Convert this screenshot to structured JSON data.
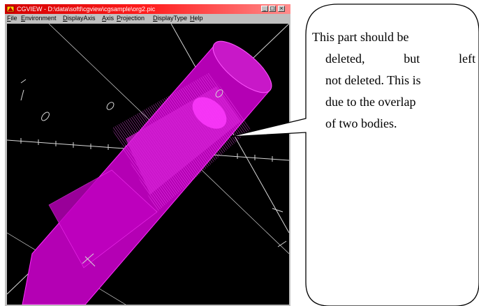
{
  "window": {
    "title": "CGVIEW - D:\\data\\softl\\cgview\\cgsample\\org2.pic",
    "icon": "app-icon",
    "buttons": [
      "minimize",
      "maximize",
      "close"
    ]
  },
  "menu": [
    "File",
    "Environment",
    "DisplayAxis",
    "Axis",
    "Projection",
    "DisplayType",
    "Help"
  ],
  "viewport": {
    "background": "#000000",
    "object_color": "#cc00cc",
    "axis_labels": [
      "0",
      "0",
      "5",
      "0",
      "-5",
      "-5"
    ]
  },
  "callout": {
    "lines": [
      "This part should be",
      "deleted,",
      "but",
      "left",
      "not deleted. This is",
      "due to the overlap",
      "of two bodies."
    ]
  }
}
